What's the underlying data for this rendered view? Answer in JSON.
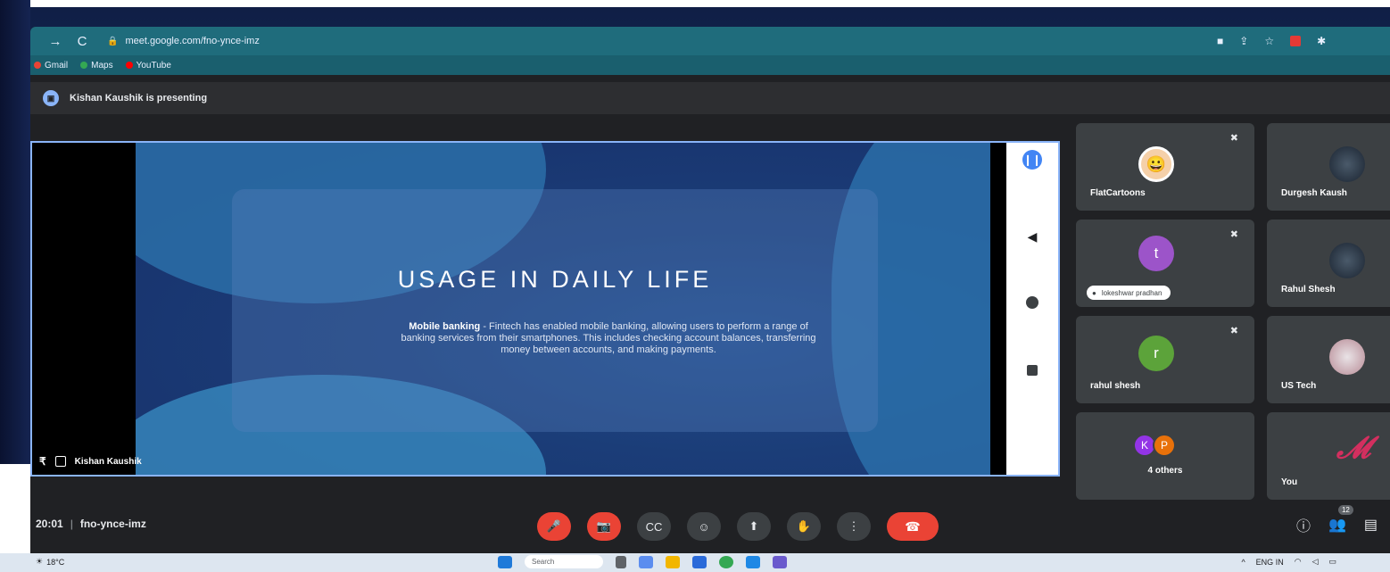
{
  "browser": {
    "url": "meet.google.com/fno-ynce-imz",
    "nav": {
      "back": "←",
      "forward": "→",
      "reload": "C"
    },
    "bookmarks": [
      {
        "label": "Gmail",
        "color": "#ea4335"
      },
      {
        "label": "Maps",
        "color": "#34a853"
      },
      {
        "label": "YouTube",
        "color": "#ff0000"
      }
    ]
  },
  "presenting_bar": {
    "text": "Kishan Kaushik is presenting"
  },
  "slide": {
    "title": "USAGE IN DAILY LIFE",
    "body_bold": "Mobile banking",
    "body_text": " - Fintech has enabled mobile banking, allowing users to perform a range of banking services from their smartphones. This includes checking account balances, transferring money between accounts, and making payments."
  },
  "presenter_label": "Kishan Kaushik",
  "participants": [
    {
      "name": "FlatCartoons",
      "avatar": "😀",
      "muted": true
    },
    {
      "name": "Durgesh Kaush",
      "avatar": "",
      "muted": false
    },
    {
      "name": "",
      "avatar_letter": "t",
      "speaker_pill": "lokeshwar pradhan",
      "muted": true
    },
    {
      "name": "Rahul Shesh",
      "avatar": "",
      "muted": false
    },
    {
      "name": "rahul shesh",
      "avatar_letter": "r",
      "muted": true
    },
    {
      "name": "US Tech",
      "avatar": "",
      "muted": false
    },
    {
      "name": "4 others",
      "mini_avatars": [
        "K",
        "P"
      ]
    },
    {
      "name": "You",
      "avatar": ""
    }
  ],
  "meeting": {
    "time": "20:01",
    "code": "fno-ynce-imz",
    "participant_count": "12"
  },
  "controls": {
    "mic": "🎤",
    "camera": "📷",
    "captions": "CC",
    "emoji": "☺",
    "present": "⬆",
    "hand": "✋",
    "more": "⋮",
    "end": "☎"
  },
  "taskbar": {
    "weather": "18°C",
    "search_placeholder": "Search",
    "lang": "ENG",
    "region": "IN"
  },
  "colors": {
    "accent_red": "#ea4335",
    "meet_blue": "#8ab4f8",
    "address_bar": "#1f6c7c"
  }
}
